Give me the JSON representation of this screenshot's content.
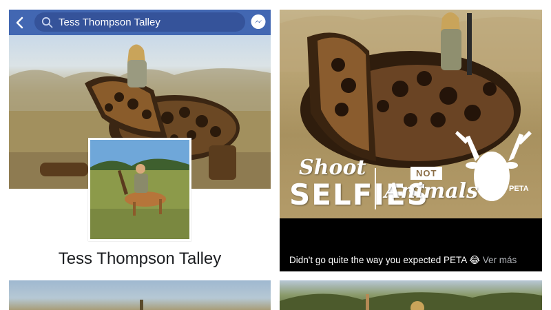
{
  "search_bar": {
    "query": "Tess Thompson Talley",
    "back_icon": "back-arrow-icon",
    "search_icon": "search-icon",
    "messenger_icon": "messenger-icon",
    "bar_color": "#4267b2"
  },
  "profile": {
    "name": "Tess Thompson Talley"
  },
  "post": {
    "overlay": {
      "shoot": "Shoot",
      "selfies": "SELFIES",
      "not": "NOT",
      "animals": "Animals",
      "brand": "PETA"
    },
    "caption": "Didn't go quite the way you expected PETA 😂",
    "see_more": "Ver más"
  }
}
